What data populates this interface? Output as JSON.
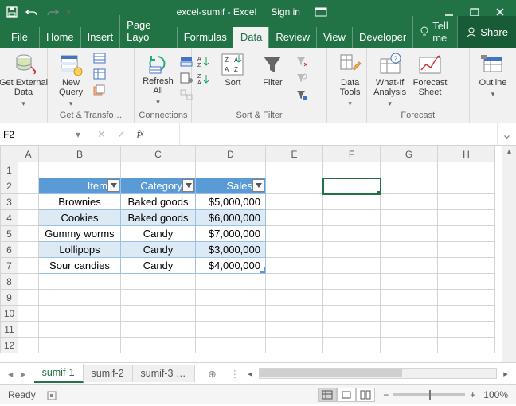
{
  "titlebar": {
    "title": "excel-sumif - Excel",
    "signin": "Sign in"
  },
  "tabs": {
    "file": "File",
    "home": "Home",
    "insert": "Insert",
    "pagelayout": "Page Layo",
    "formulas": "Formulas",
    "data": "Data",
    "review": "Review",
    "view": "View",
    "developer": "Developer",
    "tellme": "Tell me",
    "share": "Share"
  },
  "ribbon": {
    "getExternal": "Get External\nData",
    "newQuery": "New\nQuery",
    "refreshAll": "Refresh\nAll",
    "sort": "Sort",
    "filter": "Filter",
    "dataTools": "Data\nTools",
    "whatIf": "What-If\nAnalysis",
    "forecastSheet": "Forecast\nSheet",
    "outline": "Outline",
    "groupLabels": {
      "transform": "Get & Transfo…",
      "connections": "Connections",
      "sortFilter": "Sort & Filter",
      "forecast": "Forecast"
    }
  },
  "namebox": "F2",
  "formula": "",
  "columns": [
    "",
    "A",
    "B",
    "C",
    "D",
    "E",
    "F",
    "G",
    "H"
  ],
  "rowCount": 13,
  "tableHeader": {
    "item": "Item",
    "category": "Category",
    "sales": "Sales"
  },
  "tableRows": [
    {
      "item": "Brownies",
      "category": "Baked goods",
      "sales": "$5,000,000"
    },
    {
      "item": "Cookies",
      "category": "Baked goods",
      "sales": "$6,000,000"
    },
    {
      "item": "Gummy worms",
      "category": "Candy",
      "sales": "$7,000,000"
    },
    {
      "item": "Lollipops",
      "category": "Candy",
      "sales": "$3,000,000"
    },
    {
      "item": "Sour candies",
      "category": "Candy",
      "sales": "$4,000,000"
    }
  ],
  "sheets": {
    "s1": "sumif-1",
    "s2": "sumif-2",
    "s3": "sumif-3",
    "more": "…"
  },
  "status": {
    "ready": "Ready",
    "zoom": "100%"
  }
}
